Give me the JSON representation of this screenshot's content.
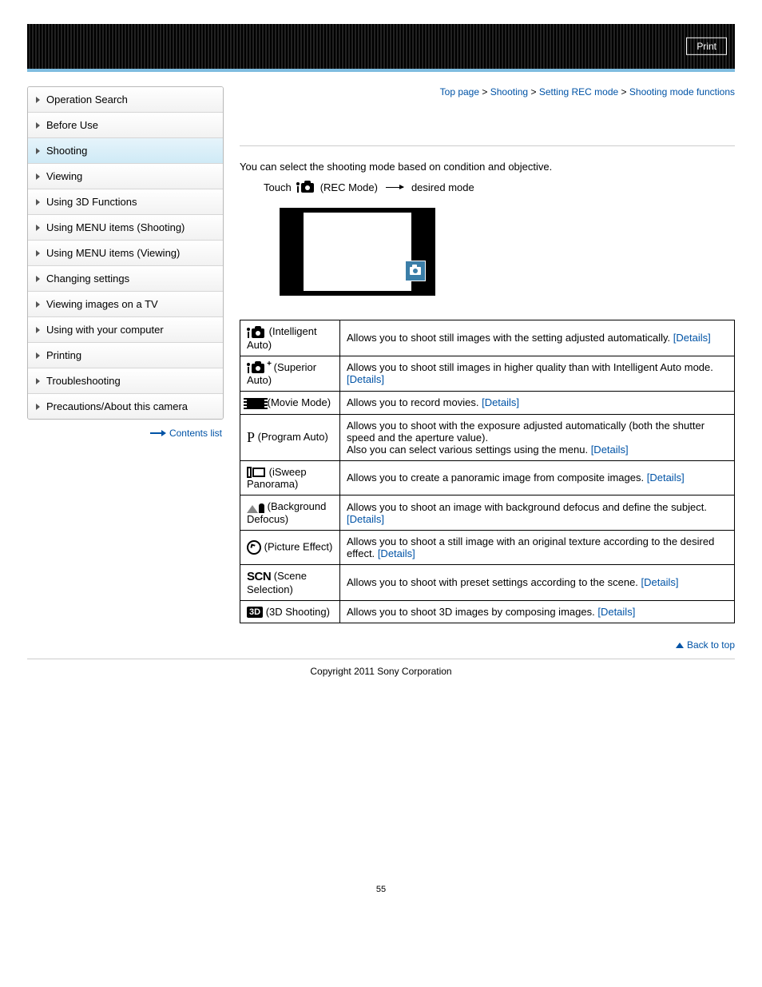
{
  "header": {
    "print": "Print"
  },
  "sidebar": {
    "items": [
      {
        "label": "Operation Search"
      },
      {
        "label": "Before Use"
      },
      {
        "label": "Shooting",
        "active": true
      },
      {
        "label": "Viewing"
      },
      {
        "label": "Using 3D Functions"
      },
      {
        "label": "Using MENU items (Shooting)"
      },
      {
        "label": "Using MENU items (Viewing)"
      },
      {
        "label": "Changing settings"
      },
      {
        "label": "Viewing images on a TV"
      },
      {
        "label": "Using with your computer"
      },
      {
        "label": "Printing"
      },
      {
        "label": "Troubleshooting"
      },
      {
        "label": "Precautions/About this camera"
      }
    ],
    "contents_list": "Contents list"
  },
  "breadcrumb": {
    "top": "Top page",
    "sep": ">",
    "l1": "Shooting",
    "l2": "Setting REC mode",
    "l3": "Shooting mode functions"
  },
  "intro": "You can select the shooting mode based on condition and objective.",
  "step": {
    "touch": "Touch",
    "rec": "(REC Mode)",
    "desired": "desired mode"
  },
  "details_label": "[Details]",
  "modes": [
    {
      "icon": "intelligent-auto",
      "name": "(Intelligent Auto)",
      "desc": "Allows you to shoot still images with the setting adjusted automatically."
    },
    {
      "icon": "superior-auto",
      "name": "(Superior Auto)",
      "desc": "Allows you to shoot still images in higher quality than with Intelligent Auto mode."
    },
    {
      "icon": "movie",
      "name": "(Movie Mode)",
      "desc": "Allows you to record movies."
    },
    {
      "icon": "program",
      "name": "(Program Auto)",
      "desc_a": "Allows you to shoot with the exposure adjusted automatically (both the shutter speed and the aperture value).",
      "desc_b": "Also you can select various settings using the menu."
    },
    {
      "icon": "sweep",
      "name": "(iSweep Panorama)",
      "desc": "Allows you to create a panoramic image from composite images."
    },
    {
      "icon": "background",
      "name": "(Background Defocus)",
      "desc": "Allows you to shoot an image with background defocus and define the subject."
    },
    {
      "icon": "picture-effect",
      "name": "(Picture Effect)",
      "desc": "Allows you to shoot a still image with an original texture according to the desired effect."
    },
    {
      "icon": "scene",
      "name": "(Scene Selection)",
      "desc": "Allows you to shoot with preset settings according to the scene."
    },
    {
      "icon": "3d",
      "name": "(3D Shooting)",
      "desc": "Allows you to shoot 3D images by composing images."
    }
  ],
  "back_to_top": "Back to top",
  "copyright": "Copyright 2011 Sony Corporation",
  "page_number": "55"
}
